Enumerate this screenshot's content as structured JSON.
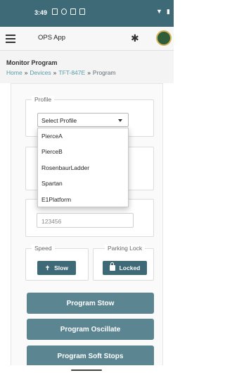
{
  "status_bar": {
    "time": "3:49"
  },
  "app_bar": {
    "title": "OPS App"
  },
  "page": {
    "title": "Monitor Program",
    "breadcrumb": [
      "Home",
      "Devices",
      "TFT-847E",
      "Program"
    ],
    "separator": "»"
  },
  "profile": {
    "legend": "Profile",
    "selected": "Select Profile",
    "options": [
      "PierceA",
      "PierceB",
      "RosenbaurLadder",
      "Spartan",
      "E1Platform"
    ]
  },
  "serial_field": {
    "value": "123456"
  },
  "speed": {
    "legend": "Speed",
    "button_label": "Slow"
  },
  "parking_lock": {
    "legend": "Parking Lock",
    "button_label": "Locked"
  },
  "actions": [
    "Program Stow",
    "Program Oscillate",
    "Program Soft Stops"
  ],
  "colors": {
    "primary": "#3e6a78",
    "action": "#5b8590",
    "link": "#5a9aa8"
  }
}
